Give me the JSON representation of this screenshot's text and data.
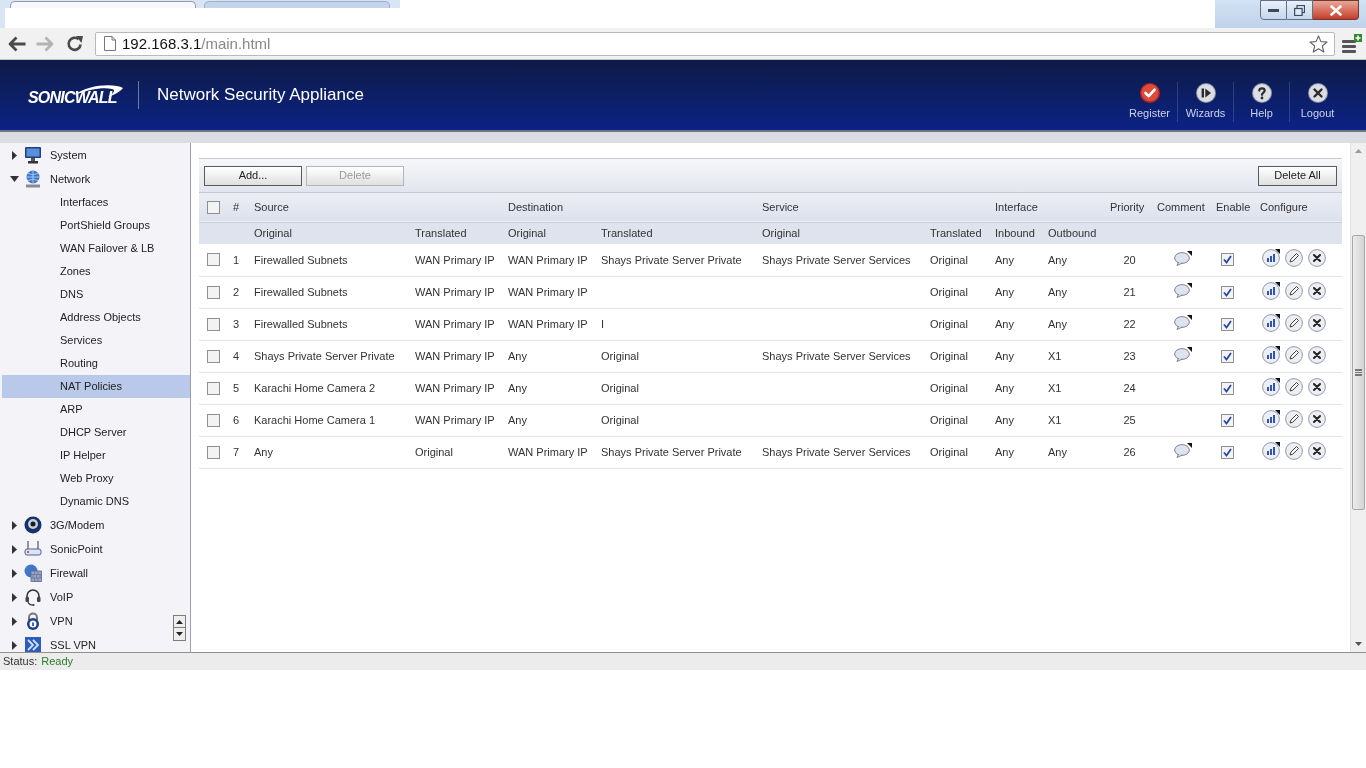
{
  "browser": {
    "tabs": [
      {
        "selected": true
      },
      {
        "selected": false
      }
    ],
    "url": "192.168.3.1/main.html"
  },
  "header": {
    "logo": "SONICWALL",
    "title": "Network Security Appliance",
    "actions": [
      {
        "kind": "register",
        "label": "Register"
      },
      {
        "kind": "wizards",
        "label": "Wizards"
      },
      {
        "kind": "help",
        "label": "Help"
      },
      {
        "kind": "logout",
        "label": "Logout"
      }
    ]
  },
  "sidebar": {
    "items": [
      {
        "kind": "system",
        "label": "System",
        "expanded": false,
        "selected": false
      },
      {
        "kind": "network",
        "label": "Network",
        "expanded": true,
        "selected": false,
        "children": [
          {
            "label": "Interfaces",
            "selected": false
          },
          {
            "label": "PortShield Groups",
            "selected": false
          },
          {
            "label": "WAN Failover & LB",
            "selected": false
          },
          {
            "label": "Zones",
            "selected": false
          },
          {
            "label": "DNS",
            "selected": false
          },
          {
            "label": "Address Objects",
            "selected": false
          },
          {
            "label": "Services",
            "selected": false
          },
          {
            "label": "Routing",
            "selected": false
          },
          {
            "label": "NAT Policies",
            "selected": true
          },
          {
            "label": "ARP",
            "selected": false
          },
          {
            "label": "DHCP Server",
            "selected": false
          },
          {
            "label": "IP Helper",
            "selected": false
          },
          {
            "label": "Web Proxy",
            "selected": false
          },
          {
            "label": "Dynamic DNS",
            "selected": false
          }
        ]
      },
      {
        "kind": "modem",
        "label": "3G/Modem",
        "expanded": false,
        "selected": false
      },
      {
        "kind": "sonicpoint",
        "label": "SonicPoint",
        "expanded": false,
        "selected": false
      },
      {
        "kind": "firewall",
        "label": "Firewall",
        "expanded": false,
        "selected": false
      },
      {
        "kind": "voip",
        "label": "VoIP",
        "expanded": false,
        "selected": false
      },
      {
        "kind": "vpn",
        "label": "VPN",
        "expanded": false,
        "selected": false
      },
      {
        "kind": "sslvpn",
        "label": "SSL VPN",
        "expanded": false,
        "selected": false
      }
    ]
  },
  "toolbar": {
    "buttons": [
      {
        "label": "Add...",
        "disabled": false
      },
      {
        "label": "Delete",
        "disabled": true
      }
    ],
    "delete_all": {
      "label": "Delete All",
      "disabled": false
    }
  },
  "table": {
    "select_all": {
      "checked": false
    },
    "column_groups": [
      {
        "label": "#"
      },
      {
        "label": "Source",
        "subcolumns": [
          "Original",
          "Translated"
        ]
      },
      {
        "label": "Destination",
        "subcolumns": [
          "Original",
          "Translated"
        ]
      },
      {
        "label": "Service",
        "subcolumns": [
          "Original",
          "Translated"
        ]
      },
      {
        "label": "Interface",
        "subcolumns": [
          "Inbound",
          "Outbound"
        ]
      },
      {
        "label": "Priority"
      },
      {
        "label": "Comment"
      },
      {
        "label": "Enable"
      },
      {
        "label": "Configure"
      }
    ],
    "rows": [
      {
        "checked": false,
        "number": "1",
        "source_original": "Firewalled Subnets",
        "source_translated": "WAN Primary IP",
        "destination_original": "WAN Primary IP",
        "destination_translated": "Shays Private Server Private",
        "service_original": "Shays Private Server Services",
        "service_translated": "Original",
        "inbound": "Any",
        "outbound": "Any",
        "priority": "20",
        "has_comment": true,
        "enabled": true
      },
      {
        "checked": false,
        "number": "2",
        "source_original": "Firewalled Subnets",
        "source_translated": "WAN Primary IP",
        "destination_original": "WAN Primary IP",
        "service_translated": "Original",
        "inbound": "Any",
        "outbound": "Any",
        "priority": "21",
        "has_comment": true,
        "enabled": true
      },
      {
        "checked": false,
        "number": "3",
        "source_original": "Firewalled Subnets",
        "source_translated": "WAN Primary IP",
        "destination_original": "WAN Primary IP",
        "destination_translated": "I",
        "service_translated": "Original",
        "inbound": "Any",
        "outbound": "Any",
        "priority": "22",
        "has_comment": true,
        "enabled": true
      },
      {
        "checked": false,
        "number": "4",
        "source_original": "Shays Private Server Private",
        "source_translated": "WAN Primary IP",
        "destination_original": "Any",
        "destination_translated": "Original",
        "service_original": "Shays Private Server Services",
        "service_translated": "Original",
        "inbound": "Any",
        "outbound": "X1",
        "priority": "23",
        "has_comment": true,
        "enabled": true
      },
      {
        "checked": false,
        "number": "5",
        "source_original": "Karachi Home Camera 2",
        "source_translated": "WAN Primary IP",
        "destination_original": "Any",
        "destination_translated": "Original",
        "service_translated": "Original",
        "inbound": "Any",
        "outbound": "X1",
        "priority": "24",
        "has_comment": false,
        "enabled": true
      },
      {
        "checked": false,
        "number": "6",
        "source_original": "Karachi Home Camera 1",
        "source_translated": "WAN Primary IP",
        "destination_original": "Any",
        "destination_translated": "Original",
        "service_translated": "Original",
        "inbound": "Any",
        "outbound": "X1",
        "priority": "25",
        "has_comment": false,
        "enabled": true
      },
      {
        "checked": false,
        "number": "7",
        "source_original": "Any",
        "source_translated": "Original",
        "destination_original": "WAN Primary IP",
        "destination_translated": "Shays Private Server Private",
        "service_original": "Shays Private Server Services",
        "service_translated": "Original",
        "inbound": "Any",
        "outbound": "Any",
        "priority": "26",
        "has_comment": true,
        "enabled": true
      }
    ]
  },
  "status_bar": {
    "label": "Status:",
    "value": "Ready"
  }
}
